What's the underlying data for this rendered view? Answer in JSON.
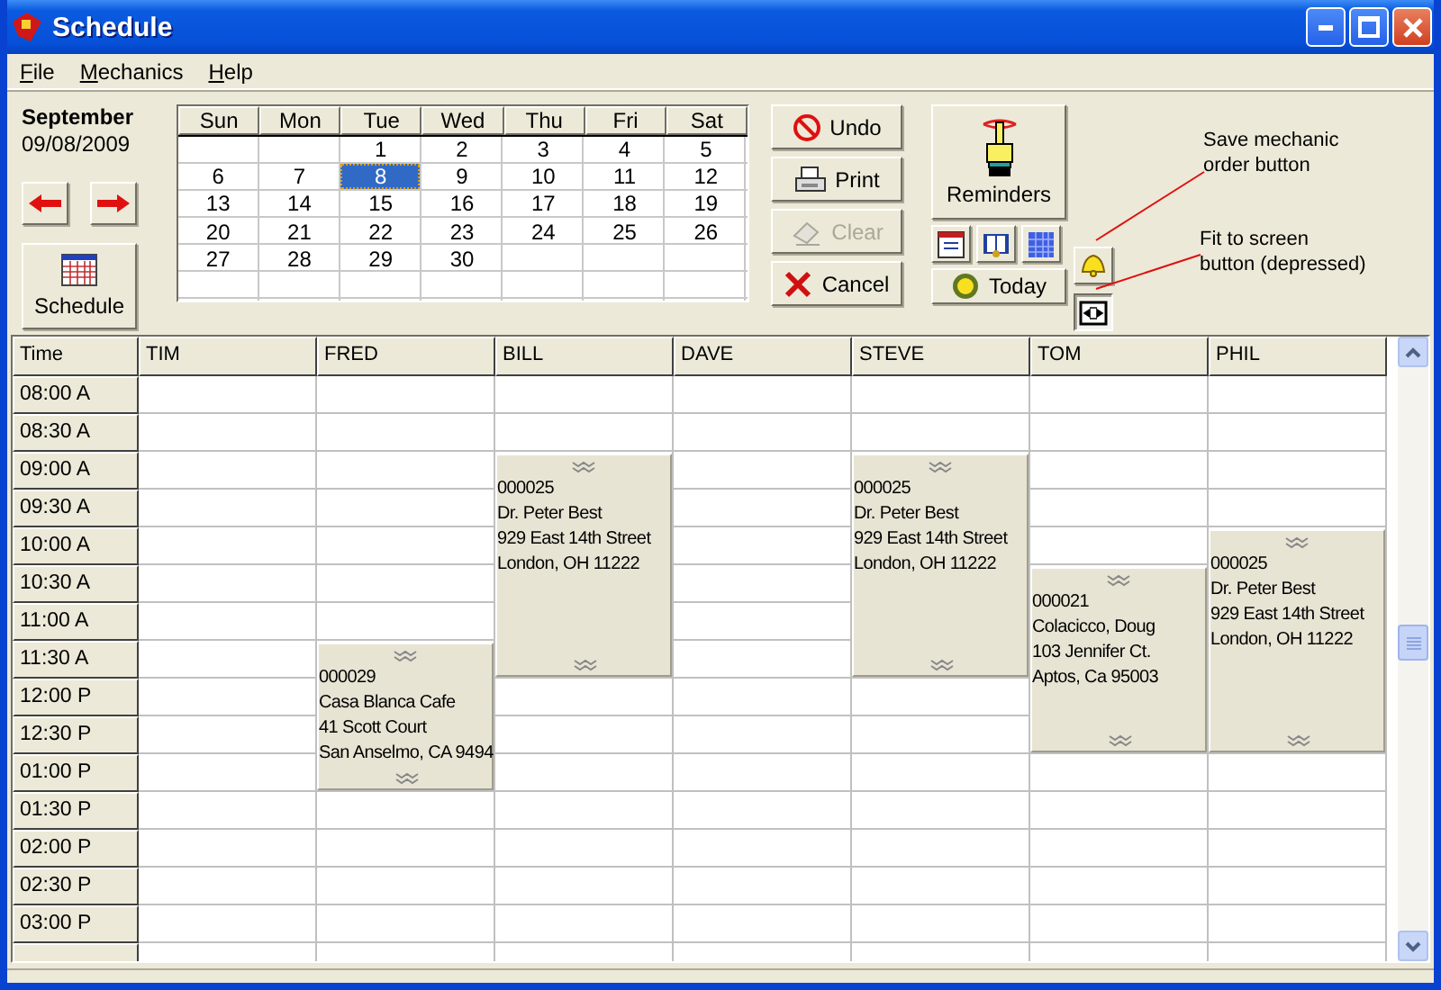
{
  "window": {
    "title": "Schedule"
  },
  "menu": [
    {
      "label": "File"
    },
    {
      "label": "Mechanics"
    },
    {
      "label": "Help"
    }
  ],
  "month": {
    "name": "September",
    "date": "09/08/2009"
  },
  "schedule_button": {
    "label": "Schedule"
  },
  "calendar": {
    "weekdays": [
      "Sun",
      "Mon",
      "Tue",
      "Wed",
      "Thu",
      "Fri",
      "Sat"
    ],
    "weeks": [
      {
        "kind": "first",
        "days": [
          {
            "day": "1",
            "selected": false
          },
          {
            "day": "2",
            "selected": false
          },
          {
            "day": "3",
            "selected": false
          },
          {
            "day": "4",
            "selected": false
          },
          {
            "day": "5",
            "selected": false
          }
        ]
      },
      {
        "kind": "week",
        "days": [
          {
            "day": "6",
            "selected": false
          },
          {
            "day": "7",
            "selected": false
          },
          {
            "day": "8",
            "selected": true
          },
          {
            "day": "9",
            "selected": false
          },
          {
            "day": "10",
            "selected": false
          },
          {
            "day": "11",
            "selected": false
          },
          {
            "day": "12",
            "selected": false
          }
        ]
      },
      {
        "kind": "week",
        "days": [
          {
            "day": "13",
            "selected": false
          },
          {
            "day": "14",
            "selected": false
          },
          {
            "day": "15",
            "selected": false
          },
          {
            "day": "16",
            "selected": false
          },
          {
            "day": "17",
            "selected": false
          },
          {
            "day": "18",
            "selected": false
          },
          {
            "day": "19",
            "selected": false
          }
        ]
      },
      {
        "kind": "week",
        "days": [
          {
            "day": "20",
            "selected": false
          },
          {
            "day": "21",
            "selected": false
          },
          {
            "day": "22",
            "selected": false
          },
          {
            "day": "23",
            "selected": false
          },
          {
            "day": "24",
            "selected": false
          },
          {
            "day": "25",
            "selected": false
          },
          {
            "day": "26",
            "selected": false
          }
        ]
      },
      {
        "kind": "week",
        "days": [
          {
            "day": "27",
            "selected": false
          },
          {
            "day": "28",
            "selected": false
          },
          {
            "day": "29",
            "selected": false
          },
          {
            "day": "30",
            "selected": false
          }
        ]
      }
    ]
  },
  "actions": [
    {
      "label": "Undo",
      "kind": "undo",
      "disabled": false
    },
    {
      "label": "Print",
      "kind": "print",
      "disabled": false
    },
    {
      "label": "Clear",
      "kind": "clear",
      "disabled": true
    },
    {
      "label": "Cancel",
      "kind": "cancel",
      "disabled": false
    }
  ],
  "reminders_button": {
    "label": "Reminders"
  },
  "today_button": {
    "label": "Today"
  },
  "fit_button": {
    "depressed": true
  },
  "annotations": [
    {
      "text": "Save mechanic\norder button",
      "kind": "save"
    },
    {
      "text": "Fit to screen\nbutton (depressed)",
      "kind": "fit"
    }
  ],
  "schedule": {
    "time_header": "Time",
    "times": [
      "08:00 A",
      "08:30 A",
      "09:00 A",
      "09:30 A",
      "10:00 A",
      "10:30 A",
      "11:00 A",
      "11:30 A",
      "12:00 P",
      "12:30 P",
      "01:00 P",
      "01:30 P",
      "02:00 P",
      "02:30 P",
      "03:00 P"
    ],
    "columns": [
      {
        "name": "TIM",
        "entries": [
          {
            "kind": "free"
          },
          {
            "kind": "free"
          },
          {
            "kind": "free"
          },
          {
            "kind": "free"
          },
          {
            "kind": "free"
          },
          {
            "kind": "free"
          },
          {
            "kind": "free"
          },
          {
            "kind": "free"
          },
          {
            "kind": "free"
          },
          {
            "kind": "free"
          },
          {
            "kind": "free"
          },
          {
            "kind": "free"
          },
          {
            "kind": "free"
          },
          {
            "kind": "free"
          },
          {
            "kind": "free"
          }
        ]
      },
      {
        "name": "FRED",
        "entries": [
          {
            "kind": "free"
          },
          {
            "kind": "free"
          },
          {
            "kind": "free"
          },
          {
            "kind": "free"
          },
          {
            "kind": "free"
          },
          {
            "kind": "free"
          },
          {
            "kind": "free"
          },
          {
            "kind": "appointment",
            "lines": [
              "000029",
              "Casa Blanca Cafe",
              "41 Scott Court",
              "San Anselmo, CA 9494"
            ]
          },
          {
            "kind": "continued"
          },
          {
            "kind": "continued"
          },
          {
            "kind": "continued"
          },
          {
            "kind": "free"
          },
          {
            "kind": "free"
          },
          {
            "kind": "free"
          },
          {
            "kind": "free"
          }
        ]
      },
      {
        "name": "BILL",
        "entries": [
          {
            "kind": "free"
          },
          {
            "kind": "free"
          },
          {
            "kind": "appointment",
            "lines": [
              "000025",
              "Dr. Peter Best",
              "929 East 14th Street",
              "London, OH 11222"
            ]
          },
          {
            "kind": "continued"
          },
          {
            "kind": "continued"
          },
          {
            "kind": "continued"
          },
          {
            "kind": "continued"
          },
          {
            "kind": "continued"
          },
          {
            "kind": "free"
          },
          {
            "kind": "free"
          },
          {
            "kind": "free"
          },
          {
            "kind": "free"
          },
          {
            "kind": "free"
          },
          {
            "kind": "free"
          },
          {
            "kind": "free"
          }
        ]
      },
      {
        "name": "DAVE",
        "entries": [
          {
            "kind": "free"
          },
          {
            "kind": "free"
          },
          {
            "kind": "free"
          },
          {
            "kind": "free"
          },
          {
            "kind": "free"
          },
          {
            "kind": "free"
          },
          {
            "kind": "free"
          },
          {
            "kind": "free"
          },
          {
            "kind": "free"
          },
          {
            "kind": "free"
          },
          {
            "kind": "free"
          },
          {
            "kind": "free"
          },
          {
            "kind": "free"
          },
          {
            "kind": "free"
          },
          {
            "kind": "free"
          }
        ]
      },
      {
        "name": "STEVE",
        "entries": [
          {
            "kind": "free"
          },
          {
            "kind": "free"
          },
          {
            "kind": "appointment",
            "lines": [
              "000025",
              "Dr. Peter Best",
              "929 East 14th Street",
              "London, OH 11222"
            ]
          },
          {
            "kind": "continued"
          },
          {
            "kind": "continued"
          },
          {
            "kind": "continued"
          },
          {
            "kind": "continued"
          },
          {
            "kind": "continued"
          },
          {
            "kind": "free"
          },
          {
            "kind": "free"
          },
          {
            "kind": "free"
          },
          {
            "kind": "free"
          },
          {
            "kind": "free"
          },
          {
            "kind": "free"
          },
          {
            "kind": "free"
          }
        ]
      },
      {
        "name": "TOM",
        "entries": [
          {
            "kind": "free"
          },
          {
            "kind": "free"
          },
          {
            "kind": "free"
          },
          {
            "kind": "free"
          },
          {
            "kind": "free"
          },
          {
            "kind": "appointment",
            "lines": [
              "000021",
              "Colacicco, Doug",
              "103 Jennifer Ct.",
              "Aptos, Ca 95003"
            ]
          },
          {
            "kind": "continued"
          },
          {
            "kind": "continued"
          },
          {
            "kind": "continued"
          },
          {
            "kind": "continued"
          },
          {
            "kind": "free"
          },
          {
            "kind": "free"
          },
          {
            "kind": "free"
          },
          {
            "kind": "free"
          },
          {
            "kind": "free"
          }
        ]
      },
      {
        "name": "PHIL",
        "entries": [
          {
            "kind": "free"
          },
          {
            "kind": "free"
          },
          {
            "kind": "free"
          },
          {
            "kind": "free"
          },
          {
            "kind": "appointment",
            "lines": [
              "000025",
              "Dr. Peter Best",
              "929 East 14th Street",
              "London, OH 11222"
            ]
          },
          {
            "kind": "continued"
          },
          {
            "kind": "continued"
          },
          {
            "kind": "continued"
          },
          {
            "kind": "continued"
          },
          {
            "kind": "continued"
          },
          {
            "kind": "free"
          },
          {
            "kind": "free"
          },
          {
            "kind": "free"
          },
          {
            "kind": "free"
          },
          {
            "kind": "free"
          }
        ]
      }
    ]
  }
}
